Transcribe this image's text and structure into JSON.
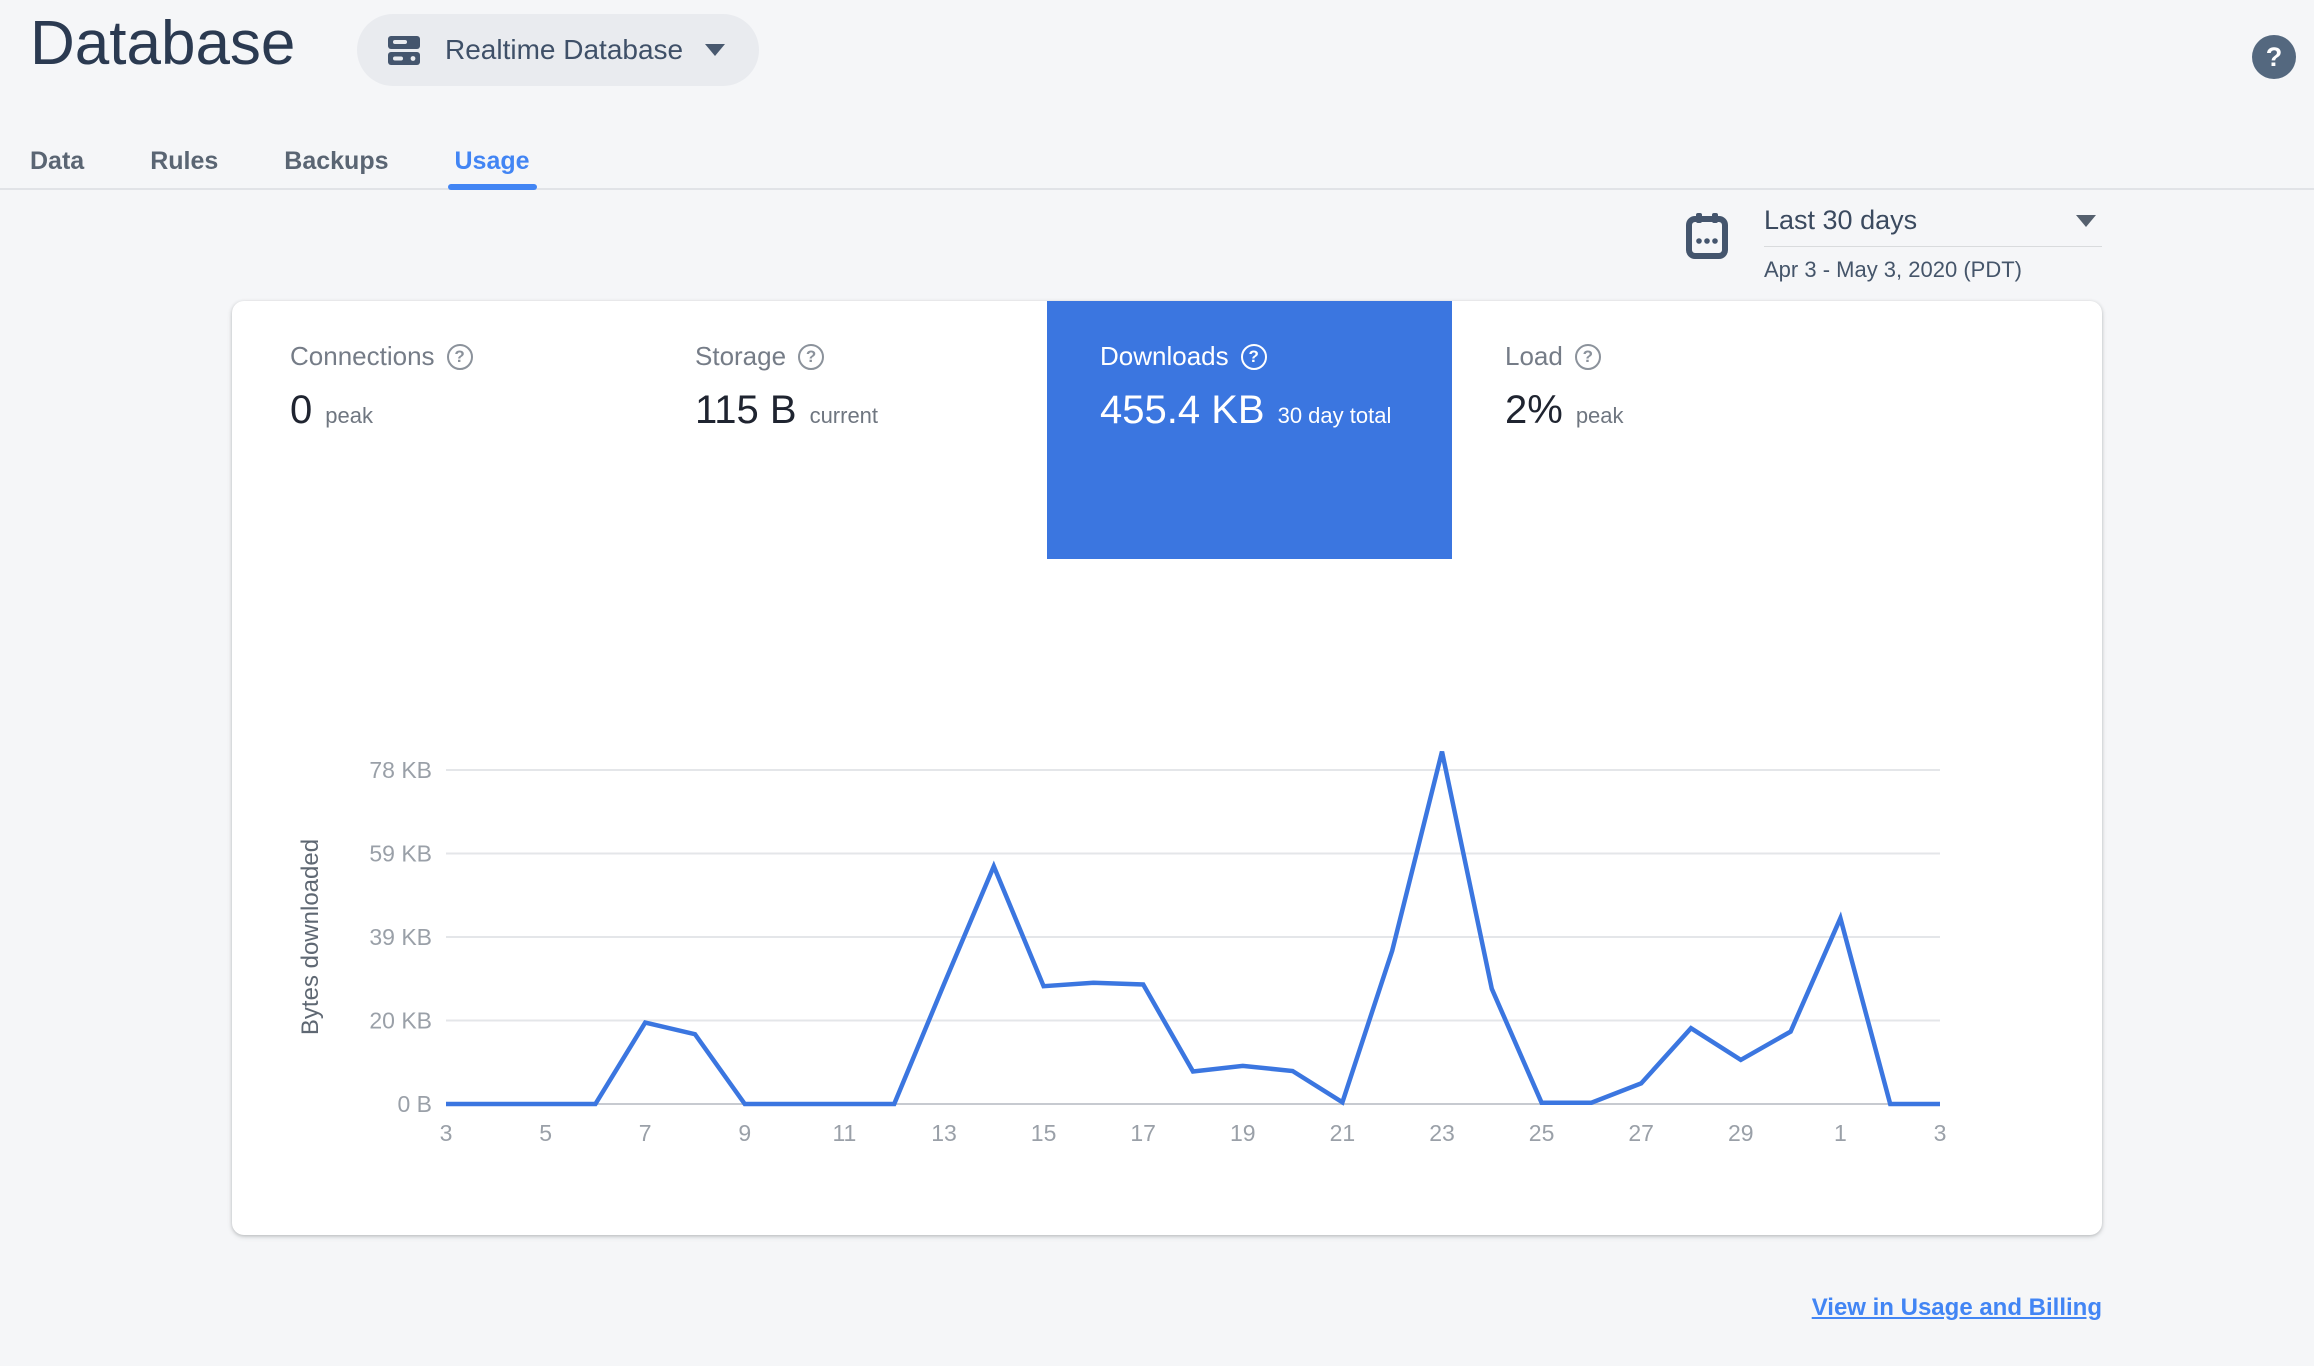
{
  "header": {
    "title": "Database",
    "database_selector": {
      "label": "Realtime Database"
    }
  },
  "icons": {
    "question": "?"
  },
  "tabs": [
    {
      "label": "Data",
      "active": false
    },
    {
      "label": "Rules",
      "active": false
    },
    {
      "label": "Backups",
      "active": false
    },
    {
      "label": "Usage",
      "active": true
    }
  ],
  "date_range": {
    "label": "Last 30 days",
    "detail": "Apr 3 - May 3, 2020 (PDT)"
  },
  "metrics": [
    {
      "label": "Connections",
      "value": "0",
      "suffix": "peak",
      "selected": false
    },
    {
      "label": "Storage",
      "value": "115 B",
      "suffix": "current",
      "selected": false
    },
    {
      "label": "Downloads",
      "value": "455.4 KB",
      "suffix": "30 day total",
      "selected": true
    },
    {
      "label": "Load",
      "value": "2%",
      "suffix": "peak",
      "selected": false
    }
  ],
  "footer": {
    "link_label": "View in Usage and Billing"
  },
  "colors": {
    "accent_blue": "#3b76e0",
    "tab_active_blue": "#4285f4",
    "link_blue": "#4285f4",
    "help_fab": "#54687f",
    "grid_line": "#e4e6e9",
    "baseline": "#c7cad0",
    "axis_text": "#9aa0a8",
    "axis_title_text": "#5f6873",
    "page_background": "#f5f6f8"
  },
  "chart_data": {
    "type": "line",
    "title": "",
    "xlabel": "",
    "ylabel": "Bytes downloaded",
    "unit": "KB",
    "ylim_kb": [
      0,
      78
    ],
    "grid": true,
    "legend": "none",
    "days": [
      3,
      4,
      5,
      6,
      7,
      8,
      9,
      10,
      11,
      12,
      13,
      14,
      15,
      16,
      17,
      18,
      19,
      20,
      21,
      22,
      23,
      24,
      25,
      26,
      27,
      28,
      29,
      30,
      31,
      32,
      33
    ],
    "series": [
      {
        "name": "Bytes downloaded",
        "values_kb": [
          0,
          0,
          0,
          0,
          19,
          16.3,
          0,
          0,
          0,
          0,
          28,
          55.5,
          27.5,
          28.3,
          27.9,
          7.6,
          8.9,
          7.7,
          0.4,
          35.8,
          82.3,
          26.9,
          0.3,
          0.3,
          4.8,
          17.7,
          10.3,
          16.9,
          43.4,
          0,
          0
        ]
      }
    ],
    "y_ticks": [
      {
        "kb": 0,
        "label": "0 B"
      },
      {
        "kb": 19.5,
        "label": "20 KB"
      },
      {
        "kb": 39,
        "label": "39 KB"
      },
      {
        "kb": 58.5,
        "label": "59 KB"
      },
      {
        "kb": 78,
        "label": "78 KB"
      }
    ],
    "x_ticks": [
      {
        "day": 3,
        "label": "3"
      },
      {
        "day": 5,
        "label": "5"
      },
      {
        "day": 7,
        "label": "7"
      },
      {
        "day": 9,
        "label": "9"
      },
      {
        "day": 11,
        "label": "11"
      },
      {
        "day": 13,
        "label": "13"
      },
      {
        "day": 15,
        "label": "15"
      },
      {
        "day": 17,
        "label": "17"
      },
      {
        "day": 19,
        "label": "19"
      },
      {
        "day": 21,
        "label": "21"
      },
      {
        "day": 23,
        "label": "23"
      },
      {
        "day": 25,
        "label": "25"
      },
      {
        "day": 27,
        "label": "27"
      },
      {
        "day": 29,
        "label": "29"
      },
      {
        "day": 31,
        "label": "1"
      },
      {
        "day": 33,
        "label": "3"
      }
    ]
  }
}
